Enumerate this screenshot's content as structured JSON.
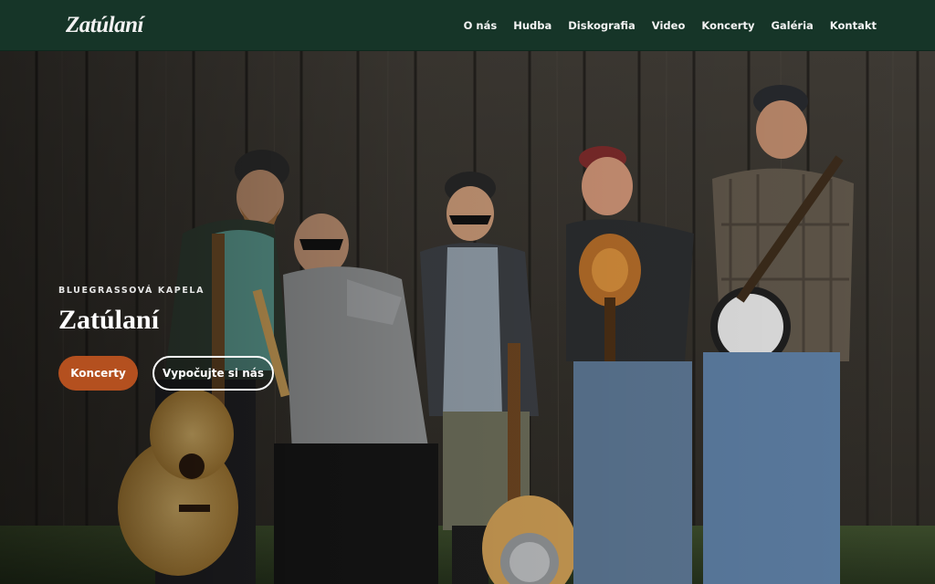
{
  "header": {
    "logo": "Zatúlaní",
    "nav": [
      "O nás",
      "Hudba",
      "Diskografia",
      "Video",
      "Koncerty",
      "Galéria",
      "Kontakt"
    ]
  },
  "hero": {
    "eyebrow": "BLUEGRASSOVÁ KAPELA",
    "title": "Zatúlaní",
    "primary_button": "Koncerty",
    "secondary_button": "Vypočujte si nás"
  },
  "colors": {
    "nav_background": "#163528",
    "accent": "#b4501f"
  }
}
